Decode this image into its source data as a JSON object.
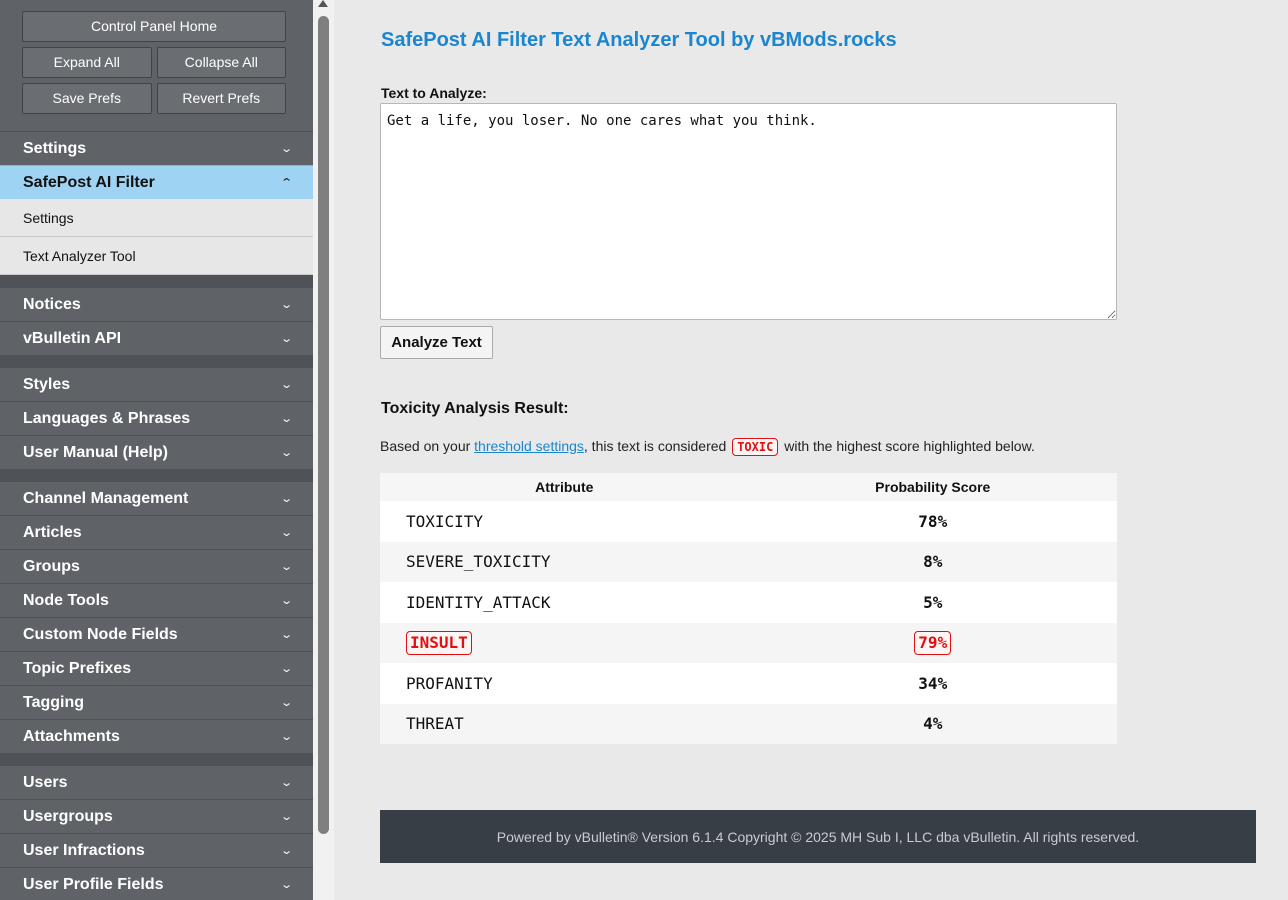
{
  "sidebar": {
    "top_buttons": {
      "home": "Control Panel Home",
      "expand_all": "Expand All",
      "collapse_all": "Collapse All",
      "save_prefs": "Save Prefs",
      "revert_prefs": "Revert Prefs"
    },
    "items": [
      {
        "label": "Settings"
      },
      {
        "label": "SafePost AI Filter"
      },
      {
        "label": "Notices"
      },
      {
        "label": "vBulletin API"
      },
      {
        "label": "Styles"
      },
      {
        "label": "Languages & Phrases"
      },
      {
        "label": "User Manual (Help)"
      },
      {
        "label": "Channel Management"
      },
      {
        "label": "Articles"
      },
      {
        "label": "Groups"
      },
      {
        "label": "Node Tools"
      },
      {
        "label": "Custom Node Fields"
      },
      {
        "label": "Topic Prefixes"
      },
      {
        "label": "Tagging"
      },
      {
        "label": "Attachments"
      },
      {
        "label": "Users"
      },
      {
        "label": "Usergroups"
      },
      {
        "label": "User Infractions"
      },
      {
        "label": "User Profile Fields"
      }
    ],
    "subitems": [
      {
        "label": "Settings"
      },
      {
        "label": "Text Analyzer Tool"
      }
    ],
    "chevron_down": "⌄",
    "chevron_up": "⌃"
  },
  "main": {
    "title": "SafePost AI Filter Text Analyzer Tool by vBMods.rocks",
    "text_label": "Text to Analyze:",
    "text_value": "Get a life, you loser. No one cares what you think.",
    "analyze_button": "Analyze Text",
    "result_title": "Toxicity Analysis Result:",
    "result_prefix": "Based on your ",
    "result_link": "threshold settings",
    "result_middle": ", this text is considered ",
    "result_badge": "TOXIC",
    "result_suffix": " with the highest score highlighted below.",
    "table": {
      "headers": [
        "Attribute",
        "Probability Score"
      ],
      "rows": [
        {
          "attribute": "TOXICITY",
          "score": "78%"
        },
        {
          "attribute": "SEVERE_TOXICITY",
          "score": "8%"
        },
        {
          "attribute": "IDENTITY_ATTACK",
          "score": "5%"
        },
        {
          "attribute": "INSULT",
          "score": "79%",
          "highlighted": true
        },
        {
          "attribute": "PROFANITY",
          "score": "34%"
        },
        {
          "attribute": "THREAT",
          "score": "4%"
        }
      ]
    },
    "footer": "Powered by vBulletin® Version 6.1.4 Copyright © 2025 MH Sub I, LLC dba vBulletin. All rights reserved."
  },
  "colors": {
    "accent": "#1a86d0",
    "sidebar_bg": "#5f6368",
    "active_item": "#9fd3f3",
    "toxic_red": "#e01010",
    "footer_bg": "#383e45"
  }
}
